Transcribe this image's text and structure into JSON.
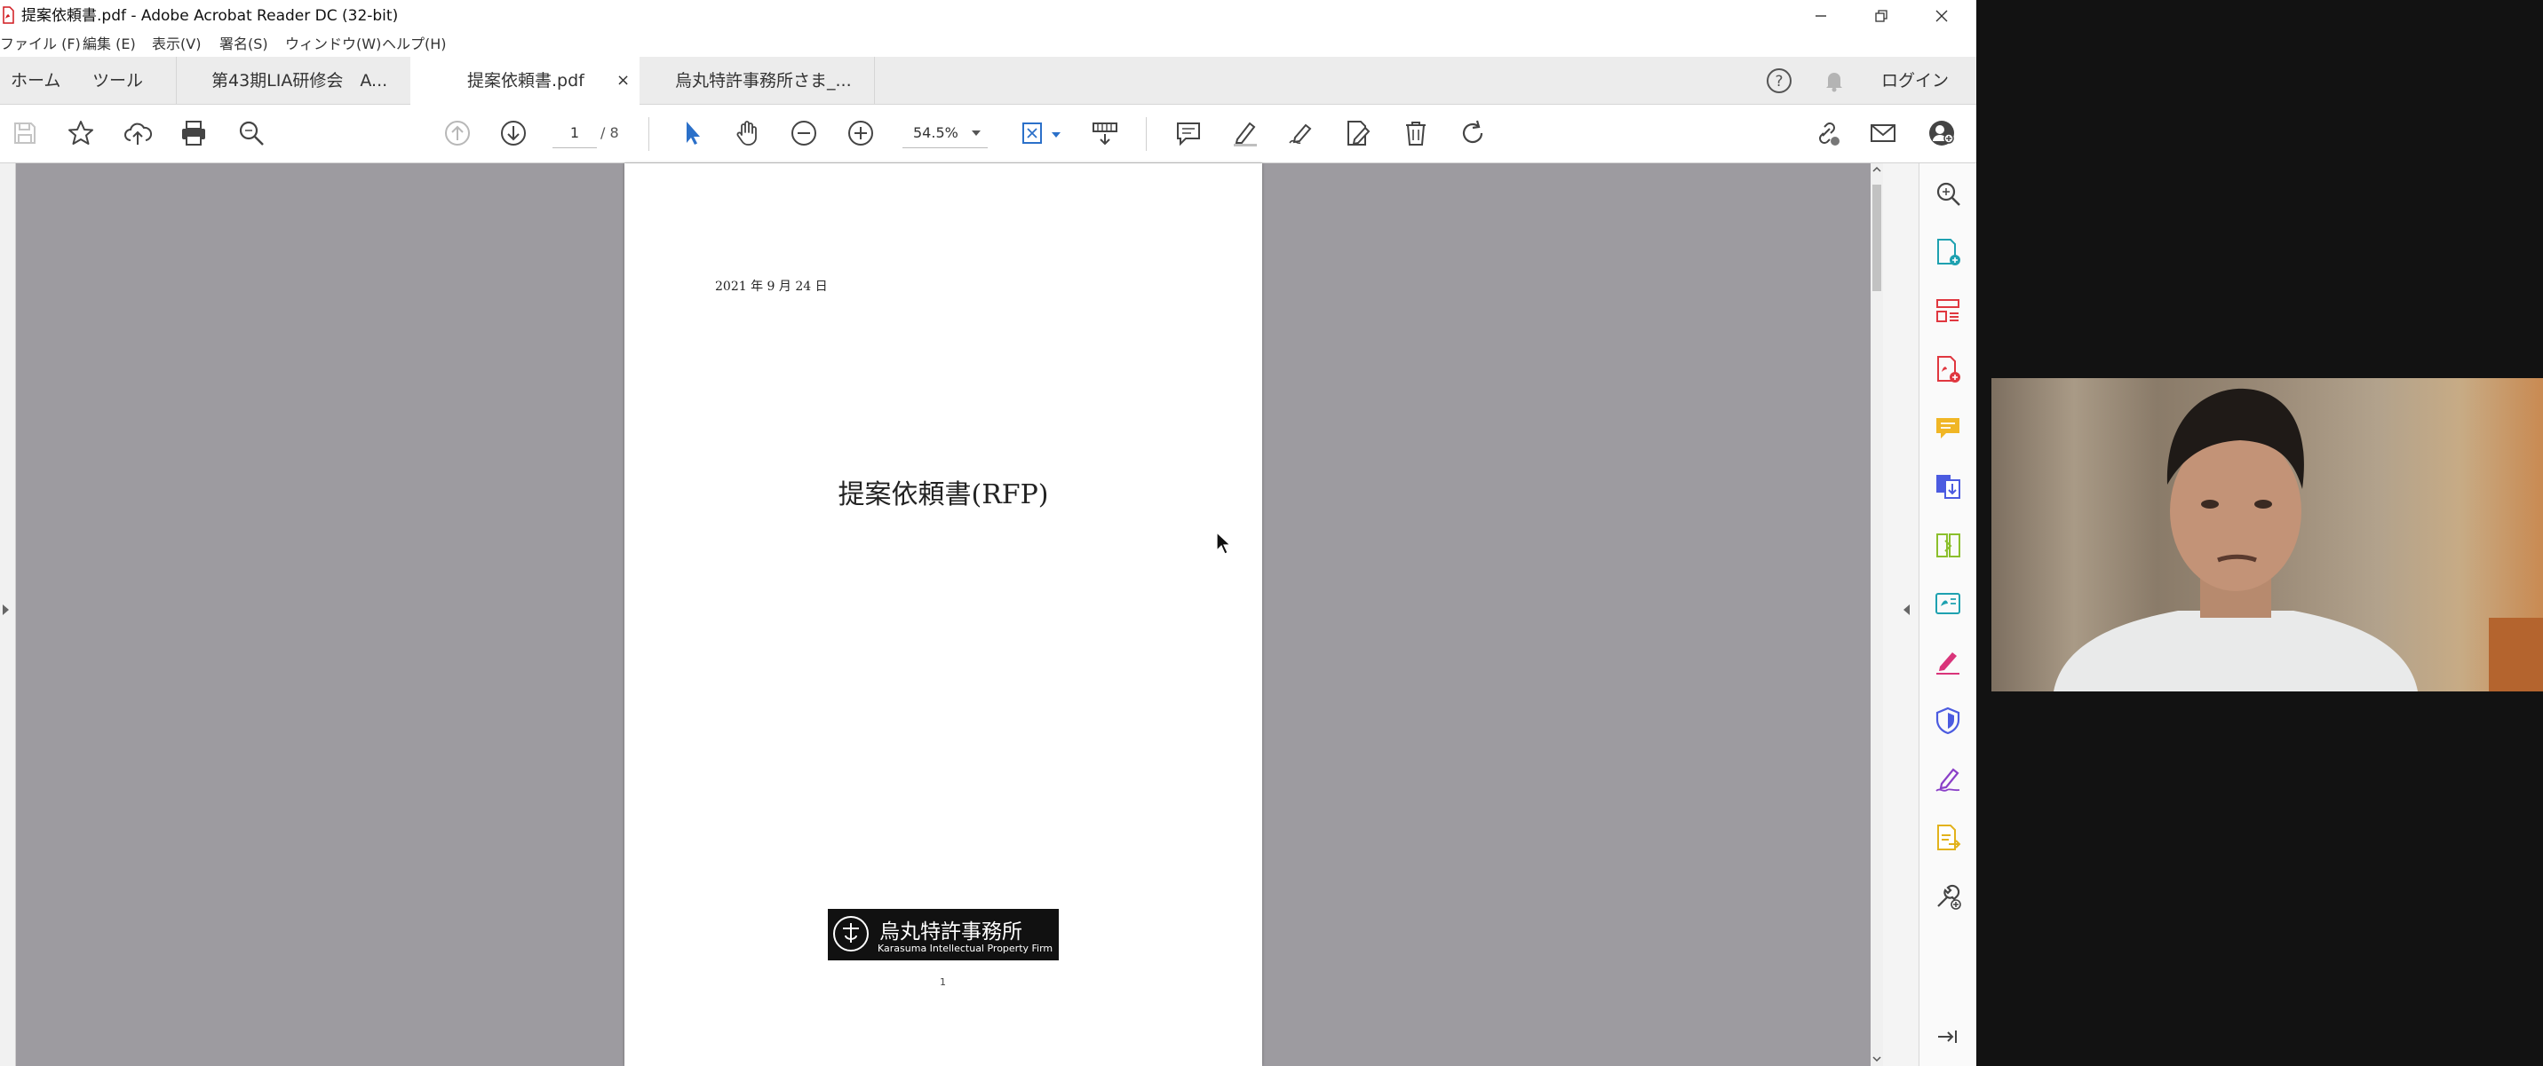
{
  "window": {
    "title": "提案依頼書.pdf - Adobe Acrobat Reader DC (32-bit)"
  },
  "menu": [
    "ファイル (F)",
    "編集 (E)",
    "表示(V)",
    "署名(S)",
    "ウィンドウ(W)",
    "ヘルプ(H)"
  ],
  "nav": {
    "home": "ホーム",
    "tools": "ツール",
    "login": "ログイン"
  },
  "tabs": [
    {
      "label": "第43期LIA研修会　A..."
    },
    {
      "label": "提案依頼書.pdf",
      "close": "×"
    },
    {
      "label": "烏丸特許事務所さま_..."
    }
  ],
  "toolbar": {
    "page_current": "1",
    "page_total": "/ 8",
    "zoom": "54.5%"
  },
  "document": {
    "date": "2021 年 9 月 24 日",
    "title": "提案依頼書(RFP)",
    "firm_name_jp": "烏丸特許事務所",
    "firm_name_en": "Karasuma Intellectual Property Firm",
    "page_marker": "1"
  },
  "colors": {
    "accent_blue": "#2b70c9",
    "viewer_gray": "#9d9ba0"
  }
}
